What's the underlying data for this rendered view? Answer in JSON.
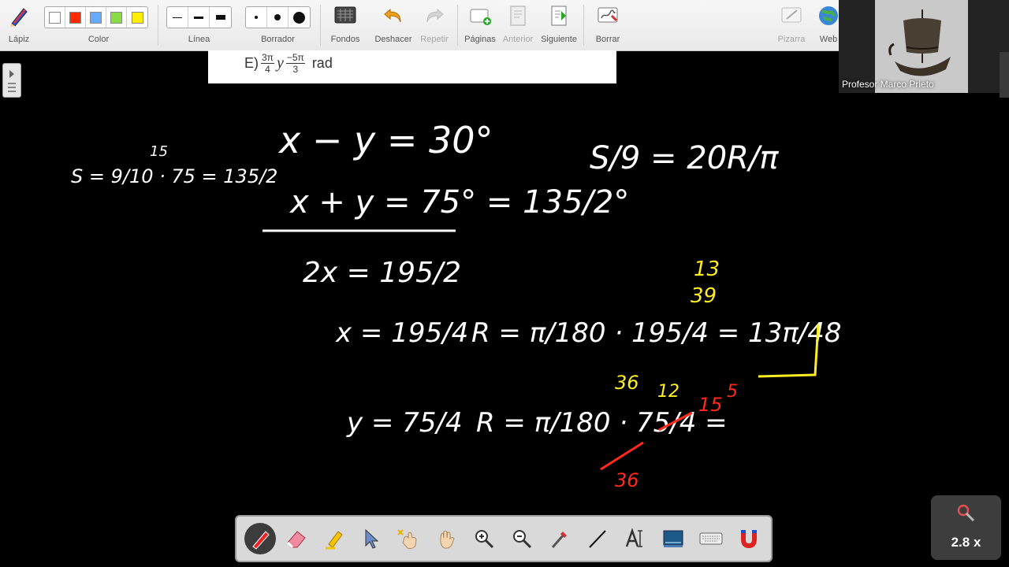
{
  "toolbar": {
    "pencil_label": "Lápiz",
    "color_label": "Color",
    "colors": [
      "#ffffff",
      "#ff2a00",
      "#66aaff",
      "#88dd44",
      "#ffee00"
    ],
    "line_label": "Línea",
    "eraser_label": "Borrador",
    "backgrounds_label": "Fondos",
    "undo_label": "Deshacer",
    "redo_label": "Repetir",
    "pages_label": "Páginas",
    "previous_label": "Anterior",
    "next_label": "Siguiente",
    "clear_label": "Borrar",
    "whiteboard_label": "Pizarra",
    "web_label": "Web"
  },
  "paper": {
    "option_letter": "E)",
    "frac1_num": "3π",
    "frac1_den": "4",
    "connector": "y",
    "frac2_num": "−5π",
    "frac2_den": "3",
    "unit": "rad"
  },
  "webcam": {
    "name": "Profesor Marco Prieto"
  },
  "board": {
    "ink_white": "#ffffff",
    "ink_yellow": "#ffee22",
    "ink_red": "#ff2a1a",
    "eq1": "x − y = 30°",
    "eq2_left": "x + y = 75° = 135/2°",
    "eq3": "2x = 195/2",
    "eq4": "x = 195/4",
    "eq5": "y = 75/4",
    "left_note": "S = 9/10 · 75 = 135/2",
    "left_note_small": "15",
    "formula": "S/9 = 20R/π",
    "r1": "R = π/180 · 195/4 = 13π/48",
    "r1_top1": "13",
    "r1_top2": "39",
    "r1_below": "36",
    "r2": "R = π/180 · 75/4 =",
    "r2_a": "12",
    "r2_b": "15",
    "r2_c": "5",
    "r2_d": "36"
  },
  "bottombar": {
    "tools": [
      "pen-icon",
      "eraser-icon",
      "highlighter-icon",
      "pointer-icon",
      "magic-hand-icon",
      "hand-icon",
      "zoom-in-icon",
      "zoom-out-icon",
      "color-picker-icon",
      "line-icon",
      "text-icon",
      "screen-icon",
      "keyboard-icon",
      "magnet-icon"
    ]
  },
  "zoom": {
    "level": "2.8 x"
  }
}
